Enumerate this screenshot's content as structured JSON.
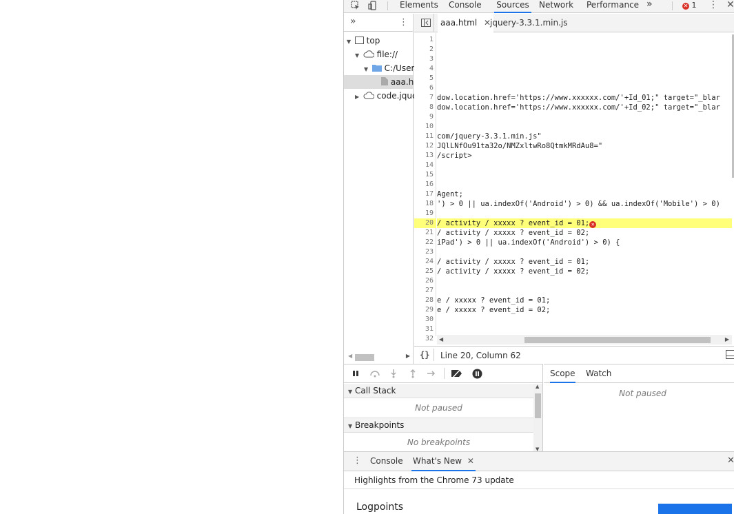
{
  "toolbar": {
    "tabs": [
      "Elements",
      "Console",
      "Sources",
      "Network",
      "Performance"
    ],
    "active_tab": "Sources",
    "more_label": "»",
    "error_count": "1"
  },
  "navigator": {
    "more_label": "»",
    "tree": [
      {
        "label": "top"
      },
      {
        "label": "file://"
      },
      {
        "label": "C:/User"
      },
      {
        "label": "aaa.h"
      },
      {
        "label": "code.jque"
      }
    ]
  },
  "editor": {
    "tabs": [
      {
        "label": "aaa.html",
        "closable": true
      },
      {
        "label": "jquery-3.3.1.min.js",
        "closable": false
      }
    ],
    "lines": [
      {
        "n": "1",
        "t": ""
      },
      {
        "n": "2",
        "t": ""
      },
      {
        "n": "3",
        "t": ""
      },
      {
        "n": "4",
        "t": ""
      },
      {
        "n": "5",
        "t": ""
      },
      {
        "n": "6",
        "t": ""
      },
      {
        "n": "7",
        "t": "dow.location.href='https://www.xxxxxx.com/'+Id_01;\" target=\"_blar"
      },
      {
        "n": "8",
        "t": "dow.location.href='https://www.xxxxxx.com/'+Id_02;\" target=\"_blar"
      },
      {
        "n": "9",
        "t": ""
      },
      {
        "n": "10",
        "t": ""
      },
      {
        "n": "11",
        "t": "com/jquery-3.3.1.min.js\""
      },
      {
        "n": "12",
        "t": "JQlLNfOu91ta32o/NMZxltwRo8QtmkMRdAu8=\""
      },
      {
        "n": "13",
        "t": "/script>"
      },
      {
        "n": "14",
        "t": ""
      },
      {
        "n": "15",
        "t": ""
      },
      {
        "n": "16",
        "t": ""
      },
      {
        "n": "17",
        "t": "Agent;"
      },
      {
        "n": "18",
        "t": "') > 0 || ua.indexOf('Android') > 0) && ua.indexOf('Mobile') > 0)"
      },
      {
        "n": "19",
        "t": ""
      },
      {
        "n": "20",
        "t": "/ activity / xxxxx ? event_id = 01;"
      },
      {
        "n": "21",
        "t": "/ activity / xxxxx ? event_id = 02;"
      },
      {
        "n": "22",
        "t": "iPad') > 0 || ua.indexOf('Android') > 0) {"
      },
      {
        "n": "23",
        "t": ""
      },
      {
        "n": "24",
        "t": "/ activity / xxxxx ? event_id = 01;"
      },
      {
        "n": "25",
        "t": "/ activity / xxxxx ? event_id = 02;"
      },
      {
        "n": "26",
        "t": ""
      },
      {
        "n": "27",
        "t": ""
      },
      {
        "n": "28",
        "t": "e / xxxxx ? event_id = 01;"
      },
      {
        "n": "29",
        "t": "e / xxxxx ? event_id = 02;"
      },
      {
        "n": "30",
        "t": ""
      },
      {
        "n": "31",
        "t": ""
      },
      {
        "n": "32",
        "t": ""
      }
    ],
    "highlight_line": "20",
    "status": "Line 20, Column 62",
    "format_label": "{}"
  },
  "debugger": {
    "call_stack_label": "Call Stack",
    "call_stack_empty": "Not paused",
    "breakpoints_label": "Breakpoints",
    "breakpoints_empty": "No breakpoints"
  },
  "scope": {
    "tabs": [
      "Scope",
      "Watch"
    ],
    "active_tab": "Scope",
    "empty": "Not paused"
  },
  "drawer": {
    "tabs": [
      "Console",
      "What's New"
    ],
    "active_tab": "What's New",
    "subtitle": "Highlights from the Chrome 73 update",
    "heading": "Logpoints"
  }
}
